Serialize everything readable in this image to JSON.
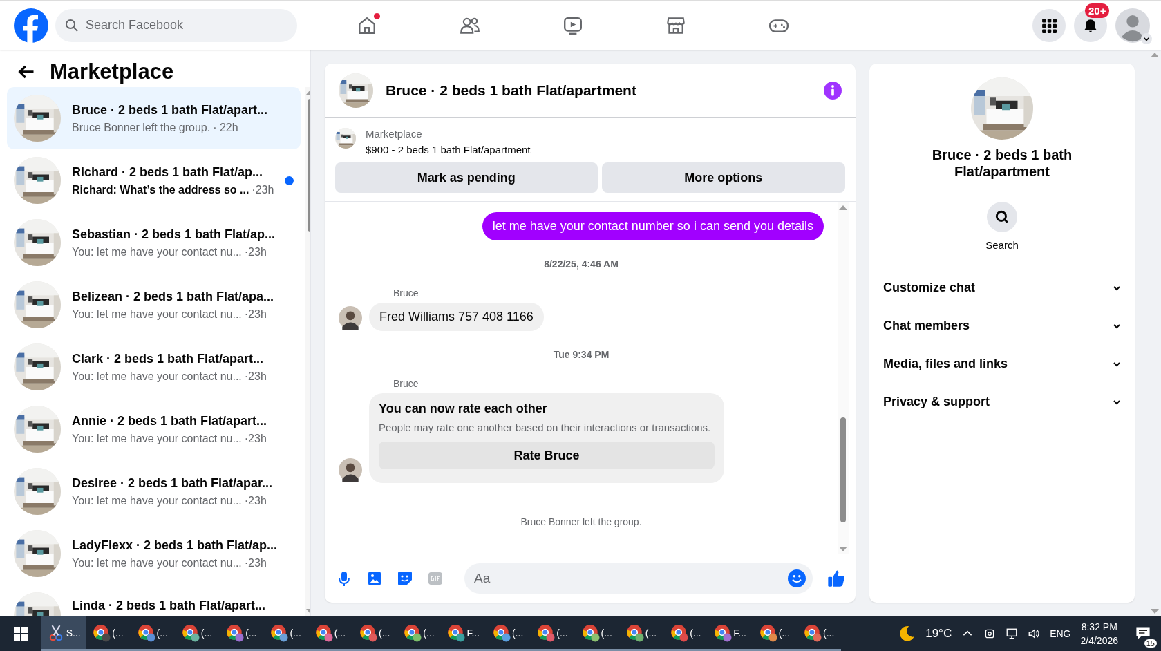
{
  "topbar": {
    "search": {
      "placeholder": "Search Facebook"
    },
    "nav": [
      {
        "kind": "home",
        "badge": true
      },
      {
        "kind": "friends",
        "badge": false
      },
      {
        "kind": "watch",
        "badge": false
      },
      {
        "kind": "marketplace",
        "badge": false
      },
      {
        "kind": "gaming",
        "badge": false
      }
    ],
    "notifications_count": "20+"
  },
  "sidebar": {
    "title": "Marketplace",
    "conversations": [
      {
        "title": "Bruce · 2 beds 1 bath Flat/apart...",
        "preview": "Bruce Bonner left the group.",
        "time": "· 22h",
        "unread": false,
        "selected": true
      },
      {
        "title": "Richard · 2 beds 1 bath Flat/ap...",
        "preview": "Richard: What’s the address so ...",
        "time": "·23h",
        "unread": true,
        "selected": false
      },
      {
        "title": "Sebastian · 2 beds 1 bath Flat/ap...",
        "preview": "You: let me have your contact nu...",
        "time": "·23h",
        "unread": false,
        "selected": false
      },
      {
        "title": "Belizean · 2 beds 1 bath Flat/apa...",
        "preview": "You: let me have your contact nu...",
        "time": "·23h",
        "unread": false,
        "selected": false
      },
      {
        "title": "Clark · 2 beds 1 bath Flat/apart...",
        "preview": "You: let me have your contact nu...",
        "time": "·23h",
        "unread": false,
        "selected": false
      },
      {
        "title": "Annie · 2 beds 1 bath Flat/apart...",
        "preview": "You: let me have your contact nu...",
        "time": "·23h",
        "unread": false,
        "selected": false
      },
      {
        "title": "Desiree · 2 beds 1 bath Flat/apar...",
        "preview": "You: let me have your contact nu...",
        "time": "·23h",
        "unread": false,
        "selected": false
      },
      {
        "title": "LadyFlexx · 2 beds 1 bath Flat/ap...",
        "preview": "You: let me have your contact nu...",
        "time": "·23h",
        "unread": false,
        "selected": false
      },
      {
        "title": "Linda · 2 beds 1 bath Flat/apart...",
        "unread": false,
        "selected": false
      }
    ]
  },
  "chat": {
    "title": "Bruce · 2 beds 1 bath Flat/apartment",
    "listing": {
      "label": "Marketplace",
      "price_title": "$900 - 2 beds 1 bath Flat/apartment",
      "buttons": [
        "Mark as pending",
        "More options"
      ]
    },
    "messages": [
      {
        "kind": "outgoing",
        "text": "let me have your contact number so i can send you details"
      },
      {
        "kind": "timestamp",
        "text": "8/22/25, 4:46 AM"
      },
      {
        "kind": "incoming",
        "sender": "Bruce",
        "text": "Fred Williams 757 408 1166"
      },
      {
        "kind": "timestamp",
        "text": "Tue 9:34 PM"
      },
      {
        "kind": "rating",
        "sender": "Bruce",
        "title": "You can now rate each other",
        "text": "People may rate one another based on their interactions or transactions.",
        "button": "Rate Bruce"
      },
      {
        "kind": "event",
        "text": "Bruce Bonner left the group."
      }
    ],
    "composer": {
      "placeholder": "Aa"
    }
  },
  "details": {
    "title": "Bruce · 2 beds 1 bath Flat/apartment",
    "search_label": "Search",
    "sections": [
      {
        "label": "Customize chat",
        "expanded": false
      },
      {
        "label": "Chat members",
        "expanded": false
      },
      {
        "label": "Media, files and links",
        "expanded": false
      },
      {
        "label": "Privacy & support",
        "expanded": false
      }
    ]
  },
  "taskbar": {
    "apps": [
      {
        "kind": "snip",
        "label": "S...",
        "active": true
      },
      {
        "kind": "browser",
        "label": "(...",
        "color": "#4a4a4a",
        "active": false
      },
      {
        "kind": "browser",
        "label": "(...",
        "color": "#5b8fd6",
        "active": false
      },
      {
        "kind": "browser",
        "label": "(...",
        "color": "#6bb3a0",
        "active": false
      },
      {
        "kind": "browser",
        "label": "(...",
        "color": "#9b6fd0",
        "active": false
      },
      {
        "kind": "browser",
        "label": "(...",
        "color": "#6a9fd8",
        "active": false
      },
      {
        "kind": "browser",
        "label": "(...",
        "color": "#e06a9a",
        "active": false
      },
      {
        "kind": "browser",
        "label": "(...",
        "color": "#e05a5a",
        "active": false
      },
      {
        "kind": "browser",
        "label": "(...",
        "color": "#7cbf6a",
        "active": false
      },
      {
        "kind": "browser",
        "label": "F...",
        "color": "#3aa0a0",
        "active": false
      },
      {
        "kind": "browser",
        "label": "(...",
        "color": "#5aa0e0",
        "active": false
      },
      {
        "kind": "browser",
        "label": "(...",
        "color": "#e05a6a",
        "active": false
      },
      {
        "kind": "browser",
        "label": "(...",
        "color": "#8cc070",
        "active": false
      },
      {
        "kind": "browser",
        "label": "(...",
        "color": "#70b070",
        "active": false
      },
      {
        "kind": "browser",
        "label": "(...",
        "color": "#e04a4a",
        "active": false
      },
      {
        "kind": "browser",
        "label": "F...",
        "color": "#a070d0",
        "active": false
      },
      {
        "kind": "browser",
        "label": "(...",
        "color": "#e08a4a",
        "active": false
      },
      {
        "kind": "browser",
        "label": "(...",
        "color": "#e06a5a",
        "active": false
      }
    ],
    "temperature": "19°C",
    "language": "ENG",
    "time": "8:32 PM",
    "date": "2/4/2026",
    "notification_count": "15"
  }
}
